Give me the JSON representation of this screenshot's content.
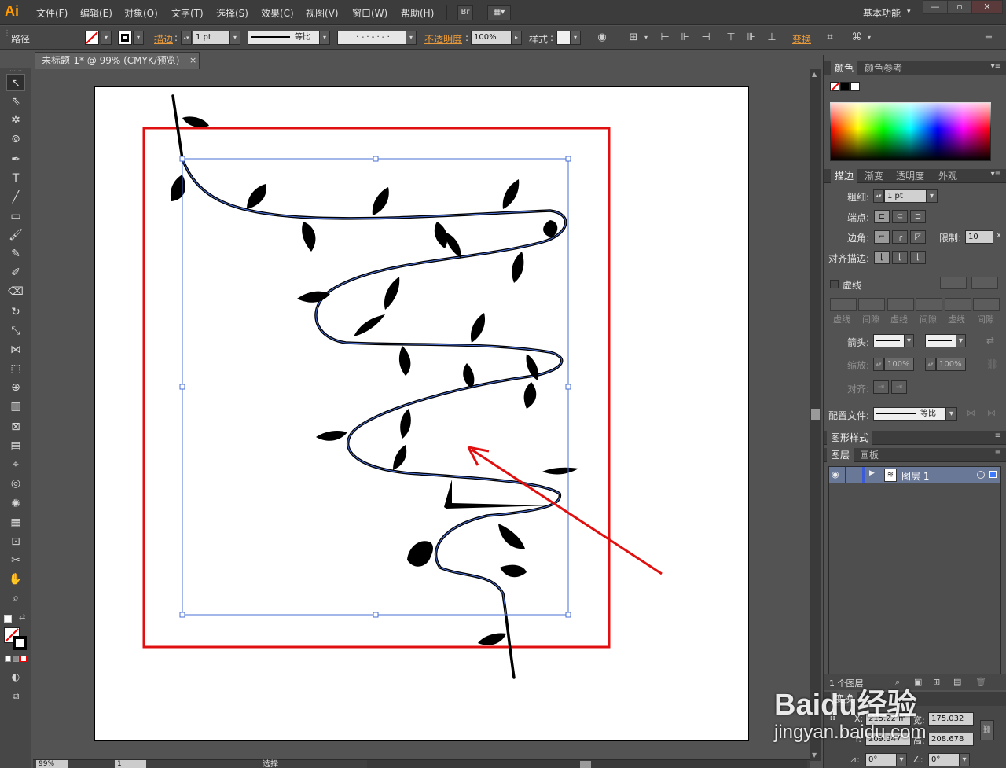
{
  "app": {
    "logo": "Ai"
  },
  "menu": [
    "文件(F)",
    "编辑(E)",
    "对象(O)",
    "文字(T)",
    "选择(S)",
    "效果(C)",
    "视图(V)",
    "窗口(W)",
    "帮助(H)"
  ],
  "menubar_right": {
    "br_label": "Br",
    "workspace": "基本功能",
    "win_min": "—",
    "win_max": "▫",
    "win_close": "✕"
  },
  "controlbar": {
    "selection_type": "路径",
    "stroke_label": "描边",
    "stroke_weight": "1 pt",
    "profile_label": "等比",
    "opacity_label": "不透明度",
    "opacity_value": "100%",
    "style_label": "样式",
    "transform_label": "变换"
  },
  "document": {
    "tab_title": "未标题-1* @ 99% (CMYK/预览)",
    "close": "×"
  },
  "status": {
    "zoom": "99%",
    "artboard_num": "1",
    "mode": "选择"
  },
  "color_panel": {
    "tabs": [
      "颜色",
      "颜色参考"
    ]
  },
  "stroke_panel": {
    "tabs": [
      "描边",
      "渐变",
      "透明度",
      "外观"
    ],
    "weight_label": "粗细:",
    "weight_value": "1 pt",
    "cap_label": "端点:",
    "corner_label": "边角:",
    "limit_label": "限制:",
    "limit_value": "10",
    "limit_unit": "x",
    "align_label": "对齐描边:",
    "dashed_label": "虚线",
    "dash_labels": [
      "虚线",
      "间隙",
      "虚线",
      "间隙",
      "虚线",
      "间隙"
    ],
    "arrow_label": "箭头:",
    "scale_label": "缩放:",
    "scale_start": "100%",
    "scale_end": "100%",
    "align_arrow_label": "对齐:",
    "profile_label": "配置文件:",
    "profile_value": "等比"
  },
  "graphic_styles": {
    "title": "图形样式"
  },
  "layers_panel": {
    "tabs": [
      "图层",
      "画板"
    ],
    "layers": [
      {
        "name": "图层 1"
      }
    ],
    "footer_count": "1 个图层"
  },
  "transform_panel": {
    "title": "变换",
    "x_label": "X:",
    "x_value": "215.22 m",
    "w_label": "宽:",
    "w_value": "175.032",
    "y_label": "Y:",
    "y_value": "209.547",
    "h_label": "高:",
    "h_value": "208.678",
    "rotate_value": "0°",
    "shear_value": "0°"
  },
  "watermark": {
    "brand": "Baidu经验",
    "url": "jingyan.baidu.com"
  },
  "colors": {
    "accent_orange": "#ff9a00",
    "highlight_red": "#e01010",
    "selection_blue": "#4a6fd6",
    "layer_row": "#6a7898"
  }
}
